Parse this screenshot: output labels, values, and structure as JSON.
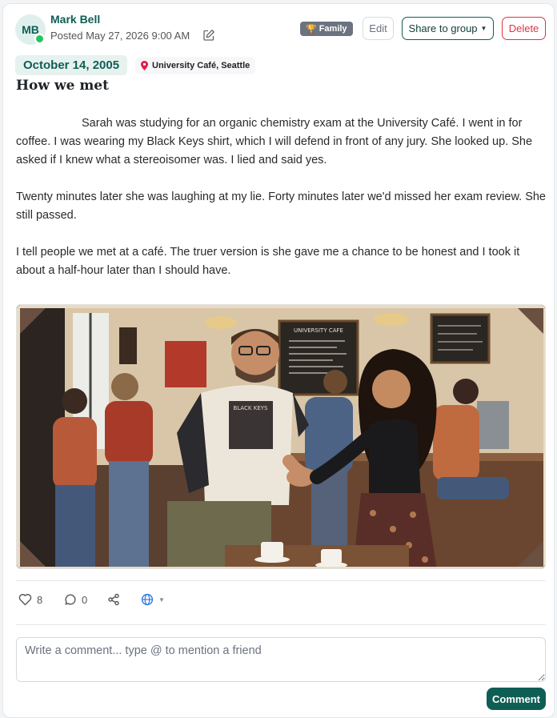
{
  "post": {
    "author": {
      "initials": "MB",
      "name": "Mark Bell",
      "online": true
    },
    "posted": "Posted May 27, 2026 9:00 AM",
    "badge": {
      "icon": "trophy-icon",
      "label": "Family"
    },
    "actions": {
      "edit": "Edit",
      "share": "Share to group",
      "delete": "Delete"
    },
    "memory_date": "October 14, 2005",
    "location": "University Café, Seattle",
    "title": "How we met",
    "paragraphs": [
      "Sarah was studying for an organic chemistry exam at the University Café. I went in for coffee. I was wearing my Black Keys shirt, which I will defend in front of any jury. She looked up. She asked if I knew what a stereoisomer was. I lied and said yes.",
      "Twenty minutes later she was laughing at my lie. Forty minutes later we'd missed her exam review. She still passed.",
      "I tell people we met at a café. The truer version is she gave me a chance to be honest and I took it about a half-hour later than I should have."
    ],
    "photo": {
      "sign_text": "UNIVERSITY CAFE",
      "shirt_text": "BLACK KEYS"
    }
  },
  "stats": {
    "likes": "8",
    "comments": "0"
  },
  "comment": {
    "placeholder": "Write a comment... type @ to mention a friend",
    "submit": "Comment"
  },
  "colors": {
    "accent": "#0f5e55",
    "online": "#22c55e",
    "danger": "#dc3545",
    "badge": "#6b7280"
  }
}
